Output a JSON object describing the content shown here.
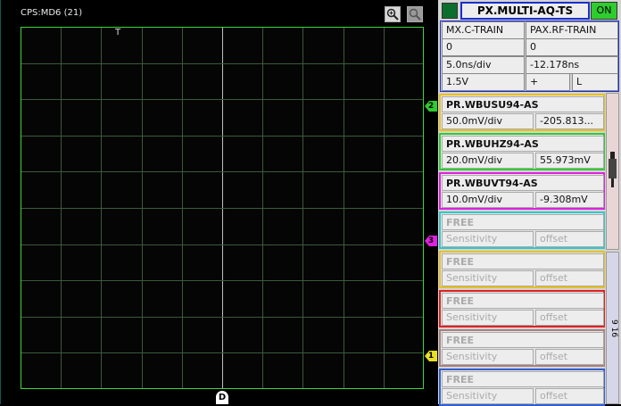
{
  "scope": {
    "title": "CPS:MD6 (21)",
    "trigger_label": "T",
    "bottom_marker": "D",
    "grid": {
      "cols": 10,
      "rows": 10
    },
    "channel_markers": [
      {
        "label": "2",
        "color": "#2ecc2e"
      },
      {
        "label": "3",
        "color": "#e020e0"
      },
      {
        "label": "1",
        "color": "#e8e020"
      }
    ]
  },
  "panel": {
    "header": {
      "title": "PX.MULTI-AQ-TS",
      "status": "ON"
    },
    "timing": {
      "row1": [
        "MX.C-TRAIN",
        "PAX.RF-TRAIN"
      ],
      "row2": [
        "0",
        "0"
      ],
      "row3": [
        "5.0ns/div",
        "-12.178ns"
      ],
      "row4": [
        "1.5V",
        "+",
        "L"
      ]
    },
    "channels": [
      {
        "name": "PR.WBUSU94-AS",
        "sensitivity": "50.0mV/div",
        "offset": "-205.813...",
        "color": "#e8c020"
      },
      {
        "name": "PR.WBUHZ94-AS",
        "sensitivity": "20.0mV/div",
        "offset": "55.973mV",
        "color": "#2ecc2e"
      },
      {
        "name": "PR.WBUVT94-AS",
        "sensitivity": "10.0mV/div",
        "offset": "-9.308mV",
        "color": "#e020e0"
      },
      {
        "name": "FREE",
        "sensitivity": "Sensitivity",
        "offset": "offset",
        "color": "#30c8c8"
      },
      {
        "name": "FREE",
        "sensitivity": "Sensitivity",
        "offset": "offset",
        "color": "#e8c020"
      },
      {
        "name": "FREE",
        "sensitivity": "Sensitivity",
        "offset": "offset",
        "color": "#e02020"
      },
      {
        "name": "FREE",
        "sensitivity": "Sensitivity",
        "offset": "offset",
        "color": "#a88080"
      },
      {
        "name": "FREE",
        "sensitivity": "Sensitivity",
        "offset": "offset",
        "color": "#3060d0"
      }
    ],
    "side_label": "9  16"
  }
}
